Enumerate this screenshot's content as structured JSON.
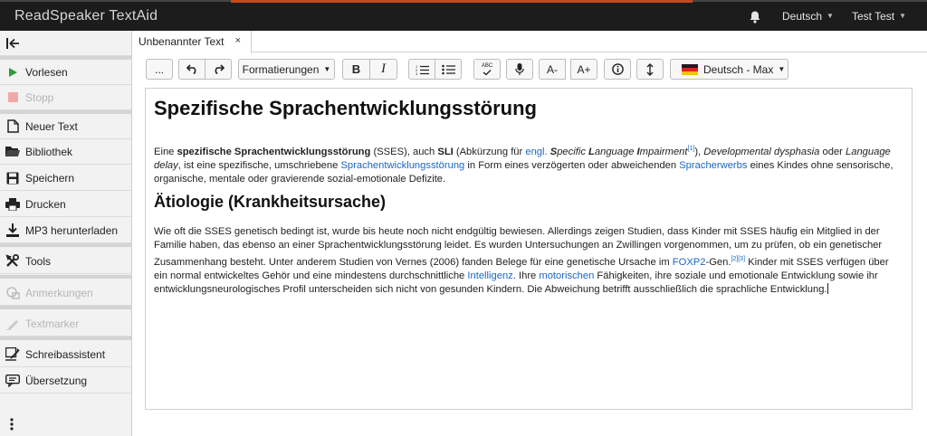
{
  "app": {
    "title": "ReadSpeaker TextAid"
  },
  "topbar": {
    "language": "Deutsch",
    "user": "Test Test"
  },
  "sidebar": {
    "items": [
      {
        "label": "Vorlesen"
      },
      {
        "label": "Stopp"
      },
      {
        "label": "Neuer Text"
      },
      {
        "label": "Bibliothek"
      },
      {
        "label": "Speichern"
      },
      {
        "label": "Drucken"
      },
      {
        "label": "MP3 herunterladen"
      },
      {
        "label": "Tools"
      },
      {
        "label": "Anmerkungen"
      },
      {
        "label": "Textmarker"
      },
      {
        "label": "Schreibassistent"
      },
      {
        "label": "Übersetzung"
      }
    ]
  },
  "tab": {
    "label": "Unbenannter Text",
    "close": "×"
  },
  "toolbar": {
    "more": "...",
    "format": "Formatierungen",
    "bold": "B",
    "italic": "I",
    "spell": "ABC",
    "font_smaller": "A-",
    "font_larger": "A+",
    "voice": "Deutsch - Max"
  },
  "document": {
    "title": "Spezifische Sprachentwicklungsstörung",
    "p1": {
      "t1": "Eine ",
      "b1": "spezifische Sprachentwicklungsstörung",
      "t2": " (SSES), auch ",
      "b2": "SLI",
      "t3": " (Abkürzung für ",
      "l1": "engl.",
      "t4": " ",
      "i1a": "S",
      "i1b": "pecific ",
      "i1c": "L",
      "i1d": "anguage ",
      "i1e": "I",
      "i1f": "mpairment",
      "s1": "[1]",
      "t5": "), ",
      "i2": "Developmental dysphasia",
      "t6": " oder ",
      "i3": "Language delay",
      "t7": ", ist eine spezifische, umschriebene ",
      "l2": "Sprachentwicklungsstörung",
      "t8": " in Form eines verzögerten oder abweichenden ",
      "l3": "Spracherwerbs",
      "t9": " eines Kindes ohne sensorische, organische, mentale oder gravierende sozial-emotionale Defizite."
    },
    "h2": "Ätiologie (Krankheitsursache)",
    "p2": {
      "t1": "Wie oft die SSES genetisch bedingt ist, wurde bis heute noch nicht endgültig bewiesen. Allerdings zeigen Studien, dass Kinder mit SSES häufig ein Mitglied in der Familie haben, das ebenso an einer Sprachentwicklungsstörung leidet. Es wurden Untersuchungen an Zwillingen vorgenommen, um zu prüfen, ob ein genetischer Zusammenhang besteht. Unter anderem Studien von Vernes (2006) fanden Belege für eine genetische Ursache im ",
      "l1": "FOXP2",
      "t2": "-Gen.",
      "s1": "[2][3]",
      "t3": " Kinder mit SSES verfügen über ein normal entwickeltes Gehör und eine mindestens durchschnittliche ",
      "l2": "Intelligenz",
      "t4": ". Ihre ",
      "l3": "motorischen",
      "t5": " Fähigkeiten, ihre soziale und emotionale Entwicklung sowie ihr entwicklungsneurologisches Profil unterscheiden sich nicht von gesunden Kindern. Die Abweichung betrifft ausschließlich die sprachliche Entwicklung."
    }
  },
  "colors": {
    "link": "#1a66c2",
    "play": "#2a9d3b",
    "topbar": "#1c1c1c"
  }
}
